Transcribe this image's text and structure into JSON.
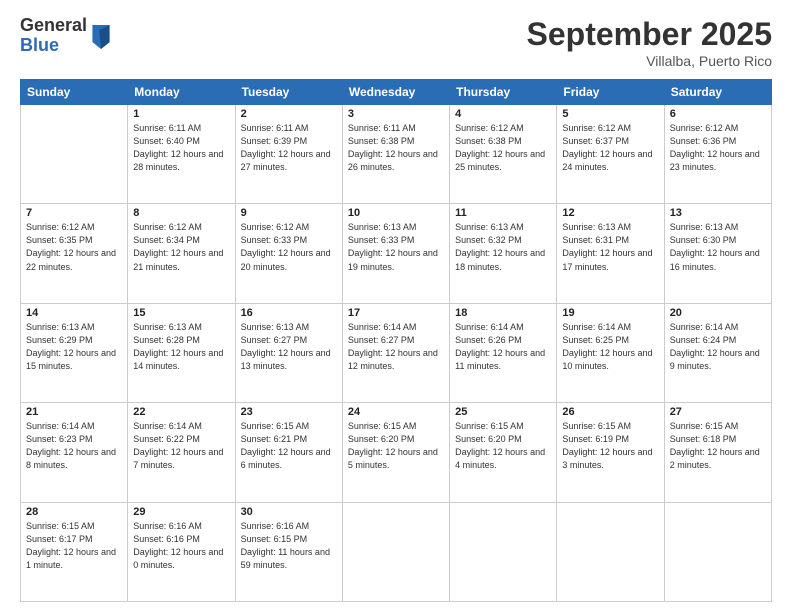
{
  "logo": {
    "general": "General",
    "blue": "Blue"
  },
  "title": "September 2025",
  "location": "Villalba, Puerto Rico",
  "weekdays": [
    "Sunday",
    "Monday",
    "Tuesday",
    "Wednesday",
    "Thursday",
    "Friday",
    "Saturday"
  ],
  "weeks": [
    [
      {
        "day": "",
        "sunrise": "",
        "sunset": "",
        "daylight": ""
      },
      {
        "day": "1",
        "sunrise": "Sunrise: 6:11 AM",
        "sunset": "Sunset: 6:40 PM",
        "daylight": "Daylight: 12 hours and 28 minutes."
      },
      {
        "day": "2",
        "sunrise": "Sunrise: 6:11 AM",
        "sunset": "Sunset: 6:39 PM",
        "daylight": "Daylight: 12 hours and 27 minutes."
      },
      {
        "day": "3",
        "sunrise": "Sunrise: 6:11 AM",
        "sunset": "Sunset: 6:38 PM",
        "daylight": "Daylight: 12 hours and 26 minutes."
      },
      {
        "day": "4",
        "sunrise": "Sunrise: 6:12 AM",
        "sunset": "Sunset: 6:38 PM",
        "daylight": "Daylight: 12 hours and 25 minutes."
      },
      {
        "day": "5",
        "sunrise": "Sunrise: 6:12 AM",
        "sunset": "Sunset: 6:37 PM",
        "daylight": "Daylight: 12 hours and 24 minutes."
      },
      {
        "day": "6",
        "sunrise": "Sunrise: 6:12 AM",
        "sunset": "Sunset: 6:36 PM",
        "daylight": "Daylight: 12 hours and 23 minutes."
      }
    ],
    [
      {
        "day": "7",
        "sunrise": "Sunrise: 6:12 AM",
        "sunset": "Sunset: 6:35 PM",
        "daylight": "Daylight: 12 hours and 22 minutes."
      },
      {
        "day": "8",
        "sunrise": "Sunrise: 6:12 AM",
        "sunset": "Sunset: 6:34 PM",
        "daylight": "Daylight: 12 hours and 21 minutes."
      },
      {
        "day": "9",
        "sunrise": "Sunrise: 6:12 AM",
        "sunset": "Sunset: 6:33 PM",
        "daylight": "Daylight: 12 hours and 20 minutes."
      },
      {
        "day": "10",
        "sunrise": "Sunrise: 6:13 AM",
        "sunset": "Sunset: 6:33 PM",
        "daylight": "Daylight: 12 hours and 19 minutes."
      },
      {
        "day": "11",
        "sunrise": "Sunrise: 6:13 AM",
        "sunset": "Sunset: 6:32 PM",
        "daylight": "Daylight: 12 hours and 18 minutes."
      },
      {
        "day": "12",
        "sunrise": "Sunrise: 6:13 AM",
        "sunset": "Sunset: 6:31 PM",
        "daylight": "Daylight: 12 hours and 17 minutes."
      },
      {
        "day": "13",
        "sunrise": "Sunrise: 6:13 AM",
        "sunset": "Sunset: 6:30 PM",
        "daylight": "Daylight: 12 hours and 16 minutes."
      }
    ],
    [
      {
        "day": "14",
        "sunrise": "Sunrise: 6:13 AM",
        "sunset": "Sunset: 6:29 PM",
        "daylight": "Daylight: 12 hours and 15 minutes."
      },
      {
        "day": "15",
        "sunrise": "Sunrise: 6:13 AM",
        "sunset": "Sunset: 6:28 PM",
        "daylight": "Daylight: 12 hours and 14 minutes."
      },
      {
        "day": "16",
        "sunrise": "Sunrise: 6:13 AM",
        "sunset": "Sunset: 6:27 PM",
        "daylight": "Daylight: 12 hours and 13 minutes."
      },
      {
        "day": "17",
        "sunrise": "Sunrise: 6:14 AM",
        "sunset": "Sunset: 6:27 PM",
        "daylight": "Daylight: 12 hours and 12 minutes."
      },
      {
        "day": "18",
        "sunrise": "Sunrise: 6:14 AM",
        "sunset": "Sunset: 6:26 PM",
        "daylight": "Daylight: 12 hours and 11 minutes."
      },
      {
        "day": "19",
        "sunrise": "Sunrise: 6:14 AM",
        "sunset": "Sunset: 6:25 PM",
        "daylight": "Daylight: 12 hours and 10 minutes."
      },
      {
        "day": "20",
        "sunrise": "Sunrise: 6:14 AM",
        "sunset": "Sunset: 6:24 PM",
        "daylight": "Daylight: 12 hours and 9 minutes."
      }
    ],
    [
      {
        "day": "21",
        "sunrise": "Sunrise: 6:14 AM",
        "sunset": "Sunset: 6:23 PM",
        "daylight": "Daylight: 12 hours and 8 minutes."
      },
      {
        "day": "22",
        "sunrise": "Sunrise: 6:14 AM",
        "sunset": "Sunset: 6:22 PM",
        "daylight": "Daylight: 12 hours and 7 minutes."
      },
      {
        "day": "23",
        "sunrise": "Sunrise: 6:15 AM",
        "sunset": "Sunset: 6:21 PM",
        "daylight": "Daylight: 12 hours and 6 minutes."
      },
      {
        "day": "24",
        "sunrise": "Sunrise: 6:15 AM",
        "sunset": "Sunset: 6:20 PM",
        "daylight": "Daylight: 12 hours and 5 minutes."
      },
      {
        "day": "25",
        "sunrise": "Sunrise: 6:15 AM",
        "sunset": "Sunset: 6:20 PM",
        "daylight": "Daylight: 12 hours and 4 minutes."
      },
      {
        "day": "26",
        "sunrise": "Sunrise: 6:15 AM",
        "sunset": "Sunset: 6:19 PM",
        "daylight": "Daylight: 12 hours and 3 minutes."
      },
      {
        "day": "27",
        "sunrise": "Sunrise: 6:15 AM",
        "sunset": "Sunset: 6:18 PM",
        "daylight": "Daylight: 12 hours and 2 minutes."
      }
    ],
    [
      {
        "day": "28",
        "sunrise": "Sunrise: 6:15 AM",
        "sunset": "Sunset: 6:17 PM",
        "daylight": "Daylight: 12 hours and 1 minute."
      },
      {
        "day": "29",
        "sunrise": "Sunrise: 6:16 AM",
        "sunset": "Sunset: 6:16 PM",
        "daylight": "Daylight: 12 hours and 0 minutes."
      },
      {
        "day": "30",
        "sunrise": "Sunrise: 6:16 AM",
        "sunset": "Sunset: 6:15 PM",
        "daylight": "Daylight: 11 hours and 59 minutes."
      },
      {
        "day": "",
        "sunrise": "",
        "sunset": "",
        "daylight": ""
      },
      {
        "day": "",
        "sunrise": "",
        "sunset": "",
        "daylight": ""
      },
      {
        "day": "",
        "sunrise": "",
        "sunset": "",
        "daylight": ""
      },
      {
        "day": "",
        "sunrise": "",
        "sunset": "",
        "daylight": ""
      }
    ]
  ]
}
